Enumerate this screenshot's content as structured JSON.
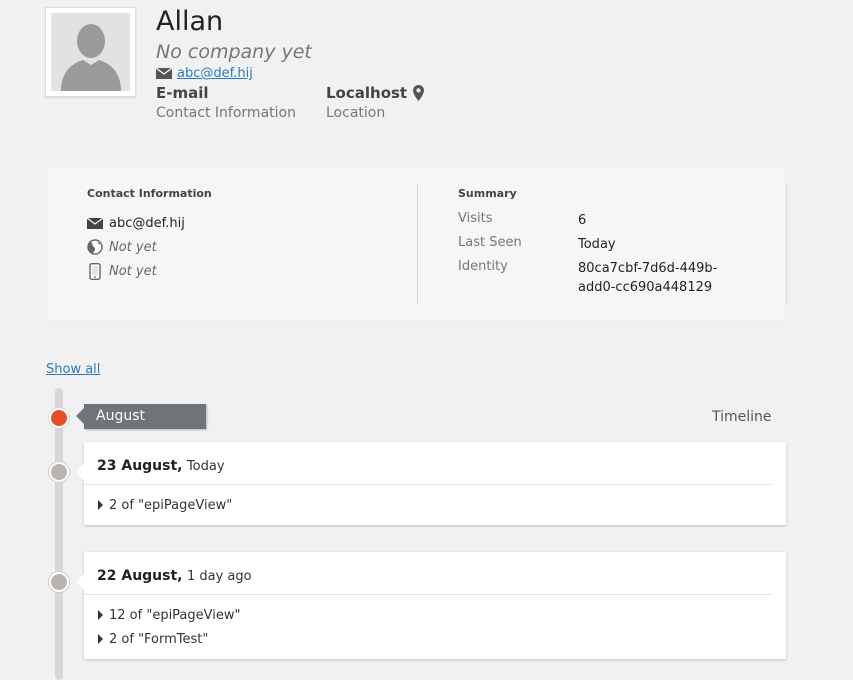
{
  "profile": {
    "name": "Allan",
    "company": "No company yet",
    "email": "abc@def.hij",
    "email_label": "E-mail",
    "email_caption": "Contact Information",
    "location_value": "Localhost",
    "location_caption": "Location"
  },
  "contact_info": {
    "title": "Contact Information",
    "email": "abc@def.hij",
    "website": "Not yet",
    "phone": "Not yet"
  },
  "summary": {
    "title": "Summary",
    "rows": [
      {
        "key": "Visits",
        "value": "6"
      },
      {
        "key": "Last Seen",
        "value": "Today"
      },
      {
        "key": "Identity",
        "value": "80ca7cbf-7d6d-449b-add0-cc690a448129"
      }
    ]
  },
  "show_all_label": "Show all",
  "timeline": {
    "label": "Timeline",
    "month": "August",
    "days": [
      {
        "date": "23 August,",
        "relative": "Today",
        "events": [
          "2 of \"epiPageView\""
        ]
      },
      {
        "date": "22 August,",
        "relative": "1 day ago",
        "events": [
          "12 of \"epiPageView\"",
          "2 of \"FormTest\""
        ]
      }
    ]
  },
  "colors": {
    "accent_dot": "#e64e2a",
    "link": "#2a7bc0",
    "month_tag": "#707478"
  }
}
